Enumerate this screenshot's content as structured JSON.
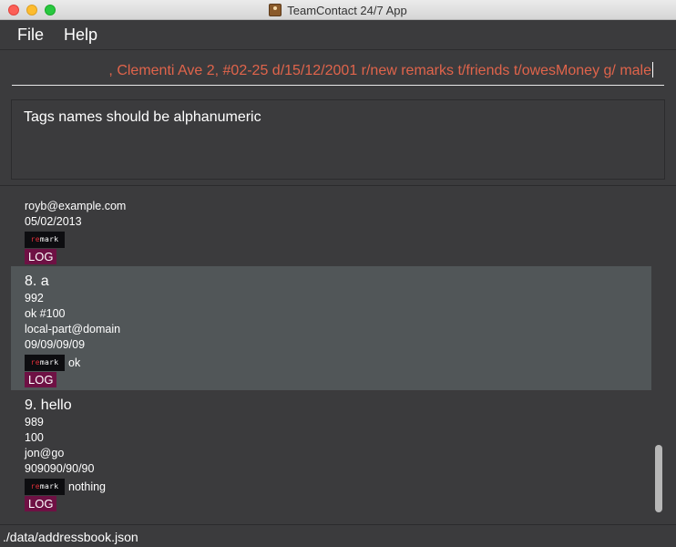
{
  "window": {
    "title": "TeamContact 24/7 App"
  },
  "menu": {
    "items": [
      "File",
      "Help"
    ]
  },
  "command": {
    "value": ", Clementi Ave 2, #02-25 d/15/12/2001 r/new remarks t/friends t/owesMoney g/ male"
  },
  "result": {
    "message": "Tags names should be alphanumeric"
  },
  "persons": [
    {
      "email": "royb@example.com",
      "date": "05/02/2013",
      "remark_tag": "remark",
      "remark_tag_prefix": "re",
      "remark_tag_suffix": "mark",
      "remark": "",
      "tag": "LOG"
    },
    {
      "index_name": "8.  a",
      "phone": "992",
      "address": "ok #100",
      "email": "local-part@domain",
      "date": "09/09/09/09",
      "remark_tag": "remark",
      "remark_tag_prefix": "re",
      "remark_tag_suffix": "mark",
      "remark": "ok",
      "tag": "LOG"
    },
    {
      "index_name": "9.  hello",
      "phone": "989",
      "address": "100",
      "email": "jon@go",
      "date": "909090/90/90",
      "remark_tag": "remark",
      "remark_tag_prefix": "re",
      "remark_tag_suffix": "mark",
      "remark": "nothing",
      "tag": "LOG"
    }
  ],
  "status": {
    "path": "./data/addressbook.json"
  },
  "colors": {
    "accent": "#e0644b",
    "tag_bg": "#6e1144",
    "selected_row": "#515658"
  },
  "icons": [
    "app-icon"
  ]
}
